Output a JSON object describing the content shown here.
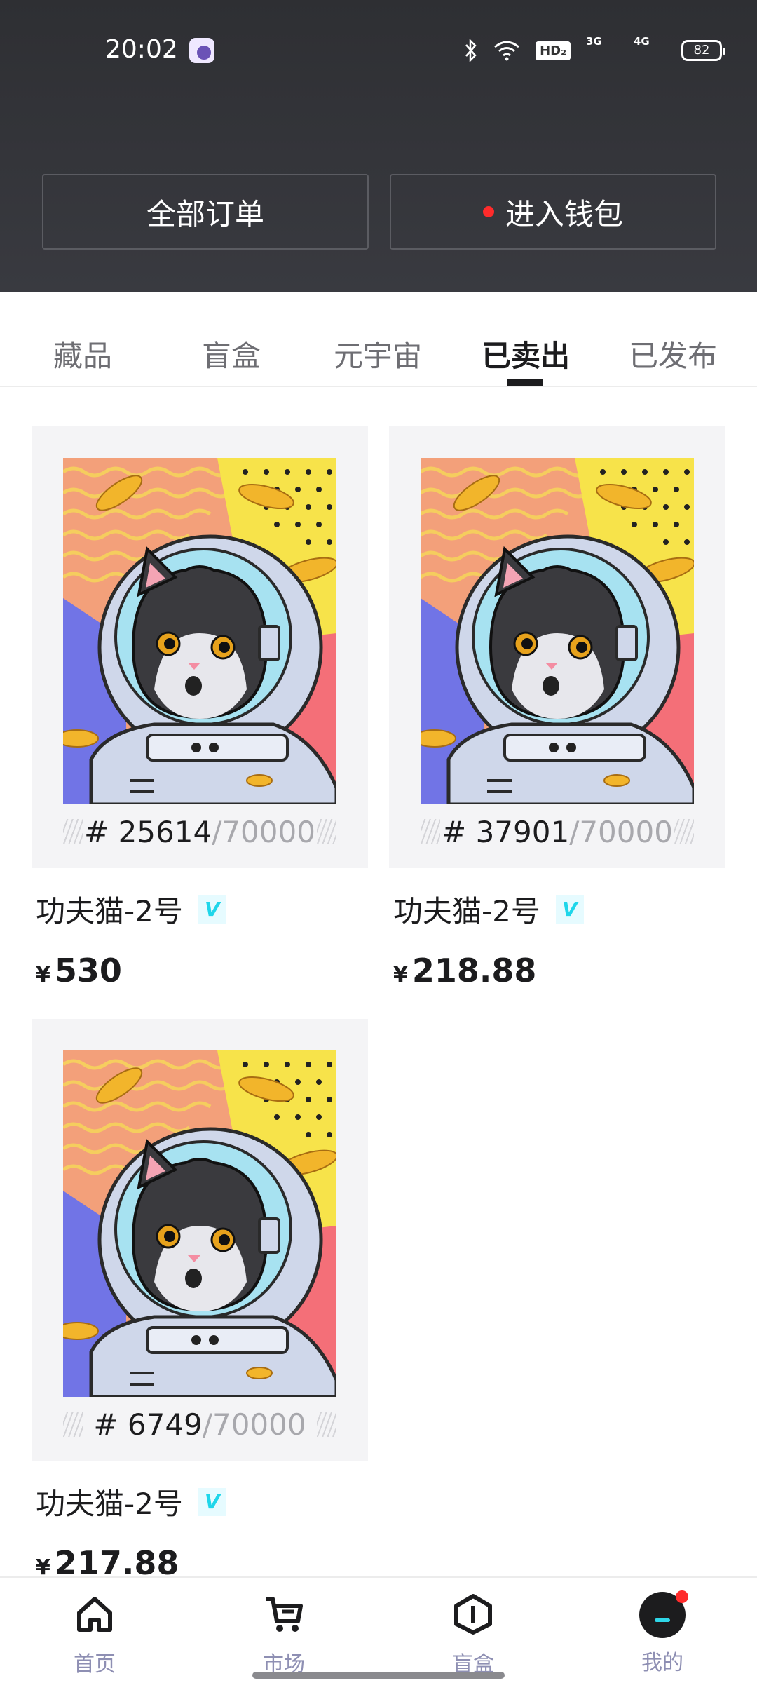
{
  "status_bar": {
    "time": "20:02",
    "battery": "82",
    "hd_label": "HD₂",
    "net1": "3G",
    "net2": "4G"
  },
  "header": {
    "orders_label": "全部订单",
    "wallet_label": "进入钱包"
  },
  "tabs": [
    {
      "label": "藏品"
    },
    {
      "label": "盲盒"
    },
    {
      "label": "元宇宙"
    },
    {
      "label": "已卖出",
      "active": true
    },
    {
      "label": "已发布"
    }
  ],
  "cards": [
    {
      "number": "# 25614",
      "total": "/70000",
      "name": "功夫猫-2号",
      "badge": "V",
      "currency": "¥",
      "price": "530"
    },
    {
      "number": "# 37901",
      "total": "/70000",
      "name": "功夫猫-2号",
      "badge": "V",
      "currency": "¥",
      "price": "218.88"
    },
    {
      "number": "# 6749",
      "total": "/70000",
      "name": "功夫猫-2号",
      "badge": "V",
      "currency": "¥",
      "price": "217.88"
    }
  ],
  "bottom_nav": [
    {
      "label": "首页",
      "icon": "home-icon"
    },
    {
      "label": "市场",
      "icon": "cart-icon"
    },
    {
      "label": "盲盒",
      "icon": "blindbox-icon"
    },
    {
      "label": "我的",
      "icon": "profile-icon"
    }
  ],
  "colors": {
    "header_bg": "#34353a",
    "accent_cyan": "#1fd6ea",
    "nav_label": "#8e8fb3",
    "red_dot": "#ff2b2b"
  }
}
